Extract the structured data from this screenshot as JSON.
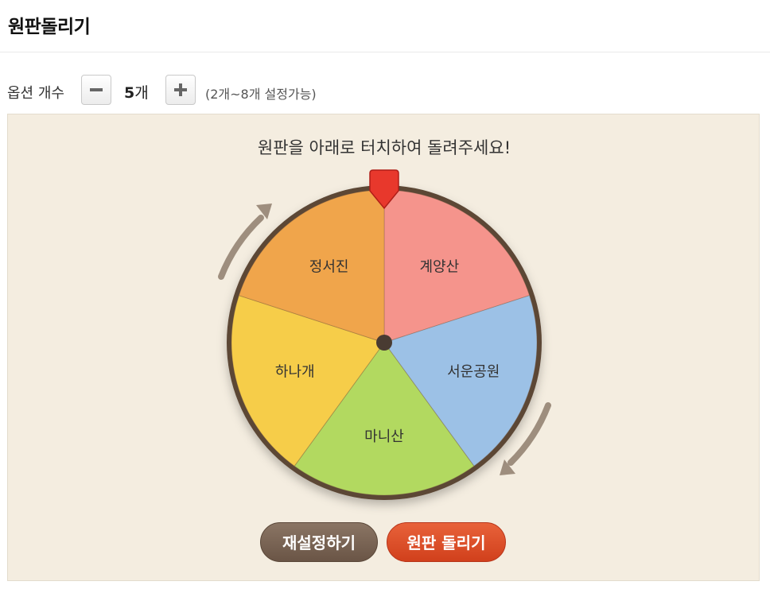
{
  "page": {
    "title": "원판돌리기"
  },
  "options": {
    "label": "옵션 개수",
    "count_value": "5",
    "count_unit": "개",
    "range_note": "(2개~8개 설정가능)"
  },
  "wheel": {
    "instruction": "원판을 아래로 터치하여 돌려주세요!",
    "segments": [
      {
        "label": "계양산",
        "color": "#f5948c"
      },
      {
        "label": "서운공원",
        "color": "#9cc1e6"
      },
      {
        "label": "마니산",
        "color": "#b2d960"
      },
      {
        "label": "하나개",
        "color": "#f6cd4a"
      },
      {
        "label": "정서진",
        "color": "#f0a54b"
      }
    ],
    "pointer_color": "#e8382c",
    "rim_color": "#5b4636",
    "arrow_color": "#9e8e7e"
  },
  "buttons": {
    "reset_label": "재설정하기",
    "spin_label": "원판 돌리기"
  }
}
